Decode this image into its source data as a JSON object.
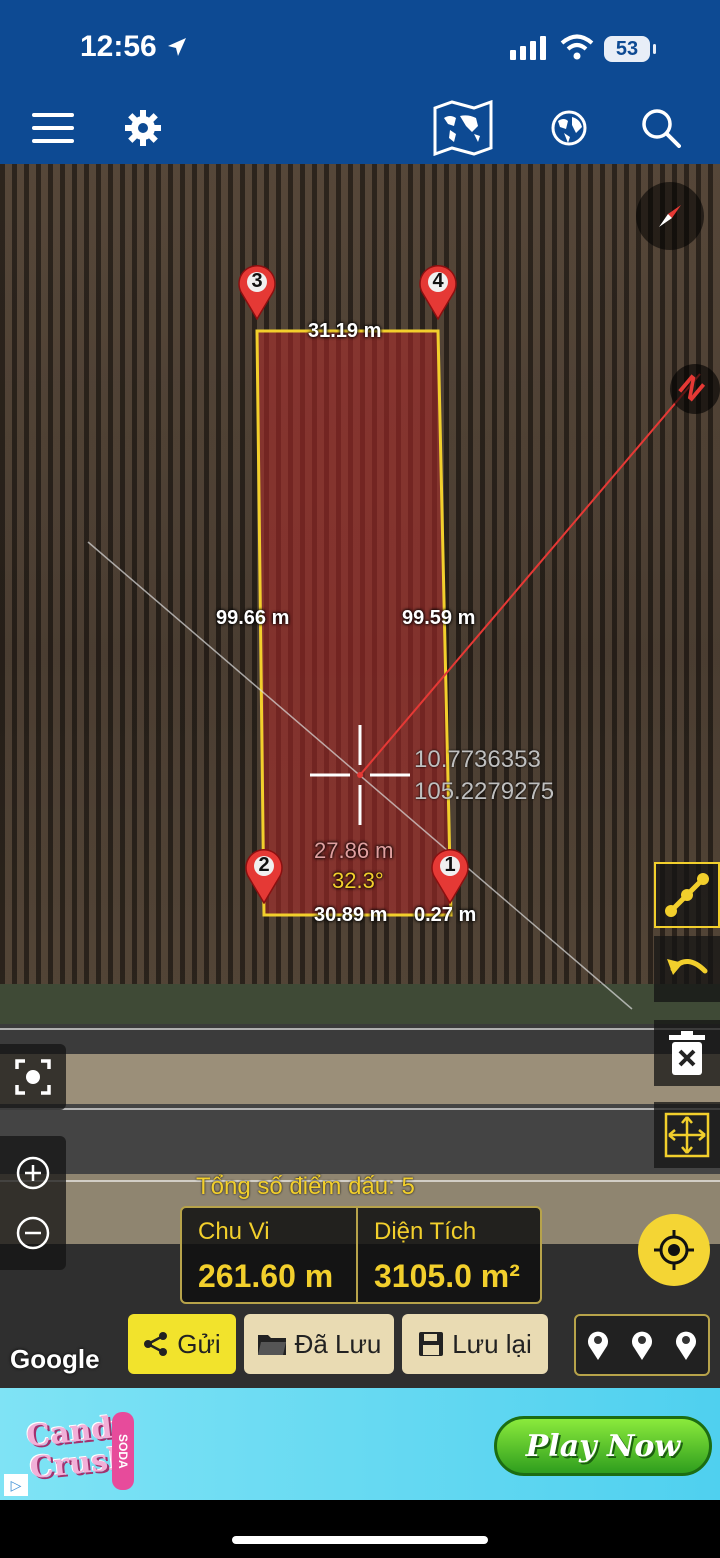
{
  "status_bar": {
    "time": "12:56",
    "battery": "53"
  },
  "toolbar": {
    "menu_icon": "hamburger-icon",
    "settings_icon": "gear-icon",
    "map_icon": "world-map-icon",
    "globe_icon": "globe-icon",
    "search_icon": "search-icon"
  },
  "map": {
    "pins": [
      "3",
      "4",
      "2",
      "1"
    ],
    "edge_labels": {
      "top": "31.19 m",
      "left": "99.66 m",
      "right": "99.59 m",
      "bottom": "30.89 m",
      "bottom_right": "0.27 m"
    },
    "current_segment": {
      "length": "27.86 m",
      "angle": "32.3°"
    },
    "coordinates": {
      "lat": "10.7736353",
      "lon": "105.2279275"
    },
    "north_label": "N"
  },
  "stats": {
    "marker_count_label": "Tổng số điểm dấu: 5",
    "perimeter_title": "Chu Vi",
    "perimeter_value": "261.60 m",
    "area_title": "Diện Tích",
    "area_value": "3105.0 m²"
  },
  "buttons": {
    "send": "Gửi",
    "saved": "Đã Lưu",
    "save": "Lưu lại"
  },
  "google_label": "Google",
  "ad": {
    "brand_line1": "Candy",
    "brand_line2": "Crush",
    "brand_sub": "SODA",
    "cta": "Play Now",
    "marker": "▷"
  },
  "colors": {
    "toolbar": "#0d4a93",
    "accent_yellow": "#f2cf2c",
    "polygon_fill": "#b02a2a",
    "pin_red": "#e53935"
  }
}
